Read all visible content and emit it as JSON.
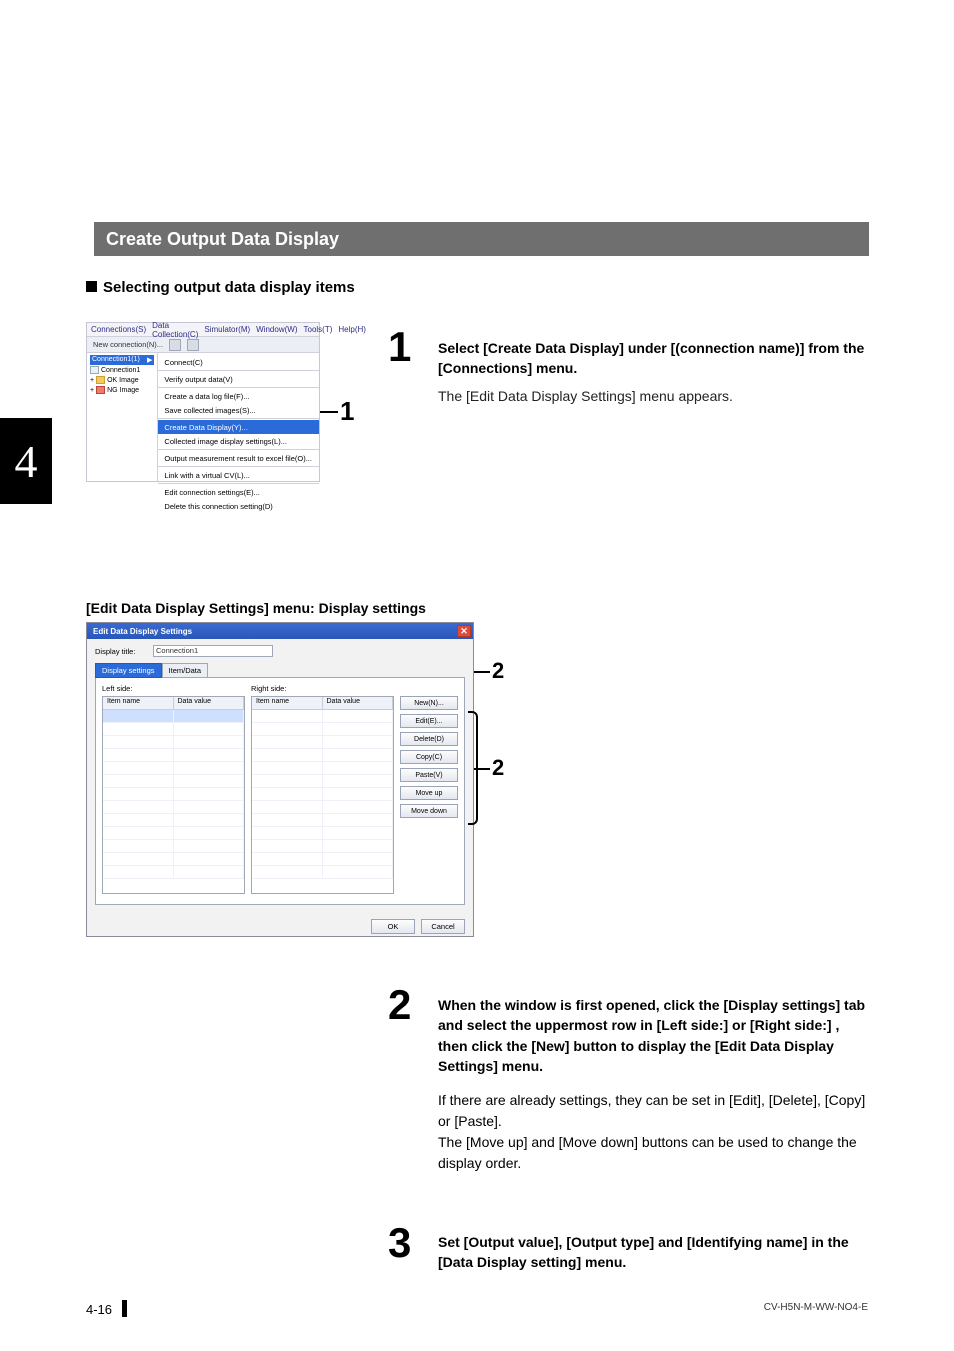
{
  "header": {
    "title": "Create Output Data Display"
  },
  "subheading": "Selecting output data display items",
  "chapter_tab": "4",
  "screenshot1": {
    "menubar": [
      "Connections(S)",
      "Data Collection(C)",
      "Simulator(M)",
      "Window(W)",
      "Tools(T)",
      "Help(H)"
    ],
    "toolbar_newconn": "New connection(N)...",
    "tree": {
      "selected": "Connection1(1)",
      "root": "Connection1",
      "ok": "OK Image",
      "ng": "NG Image"
    },
    "submenu": {
      "connect": "Connect(C)",
      "verify": "Verify output data(V)",
      "create_log": "Create a data log file(F)...",
      "save_images": "Save collected images(S)...",
      "create_display": "Create Data Display(Y)...",
      "collected_settings": "Collected image display settings(L)...",
      "output_excel": "Output measurement result to excel file(O)...",
      "link_vnl": "Link with a virtual CV(L)...",
      "edit_conn": "Edit connection settings(E)...",
      "delete_conn": "Delete this connection setting(D)"
    }
  },
  "callouts": {
    "c1": "1",
    "c2a": "2",
    "c2b": "2"
  },
  "step1": {
    "num": "1",
    "bold": "Select [Create Data Display] under [(connection name)] from the [Connections] menu.",
    "body": "The [Edit Data Display Settings] menu appears."
  },
  "shot2_caption": "[Edit Data Display Settings] menu: Display settings",
  "screenshot2": {
    "title": "Edit Data Display Settings",
    "display_title_label": "Display title:",
    "display_title_value": "Connection1",
    "tab_display": "Display settings",
    "tab_item": "Item/Data",
    "left_label": "Left side:",
    "right_label": "Right side:",
    "col_item": "Item name",
    "col_value": "Data value",
    "buttons": {
      "new": "New(N)...",
      "edit": "Edit(E)...",
      "delete": "Delete(D)",
      "copy": "Copy(C)",
      "paste": "Paste(V)",
      "moveup": "Move up",
      "movedown": "Move down"
    },
    "ok": "OK",
    "cancel": "Cancel"
  },
  "step2": {
    "num": "2",
    "bold": "When the window is first opened, click the [Display settings] tab and select the uppermost row in [Left side:] or [Right side:] , then click the [New] button to display the [Edit Data Display Settings] menu.",
    "body1": "If there are already settings, they can be set in [Edit], [Delete], [Copy] or [Paste].",
    "body2": "The [Move up] and [Move down] buttons can be used to change the display order."
  },
  "step3": {
    "num": "3",
    "bold": "Set [Output value], [Output type] and [Identifying name] in the [Data Display setting] menu."
  },
  "footer": {
    "page": "4-16",
    "code": "CV-H5N-M-WW-NO4-E"
  }
}
